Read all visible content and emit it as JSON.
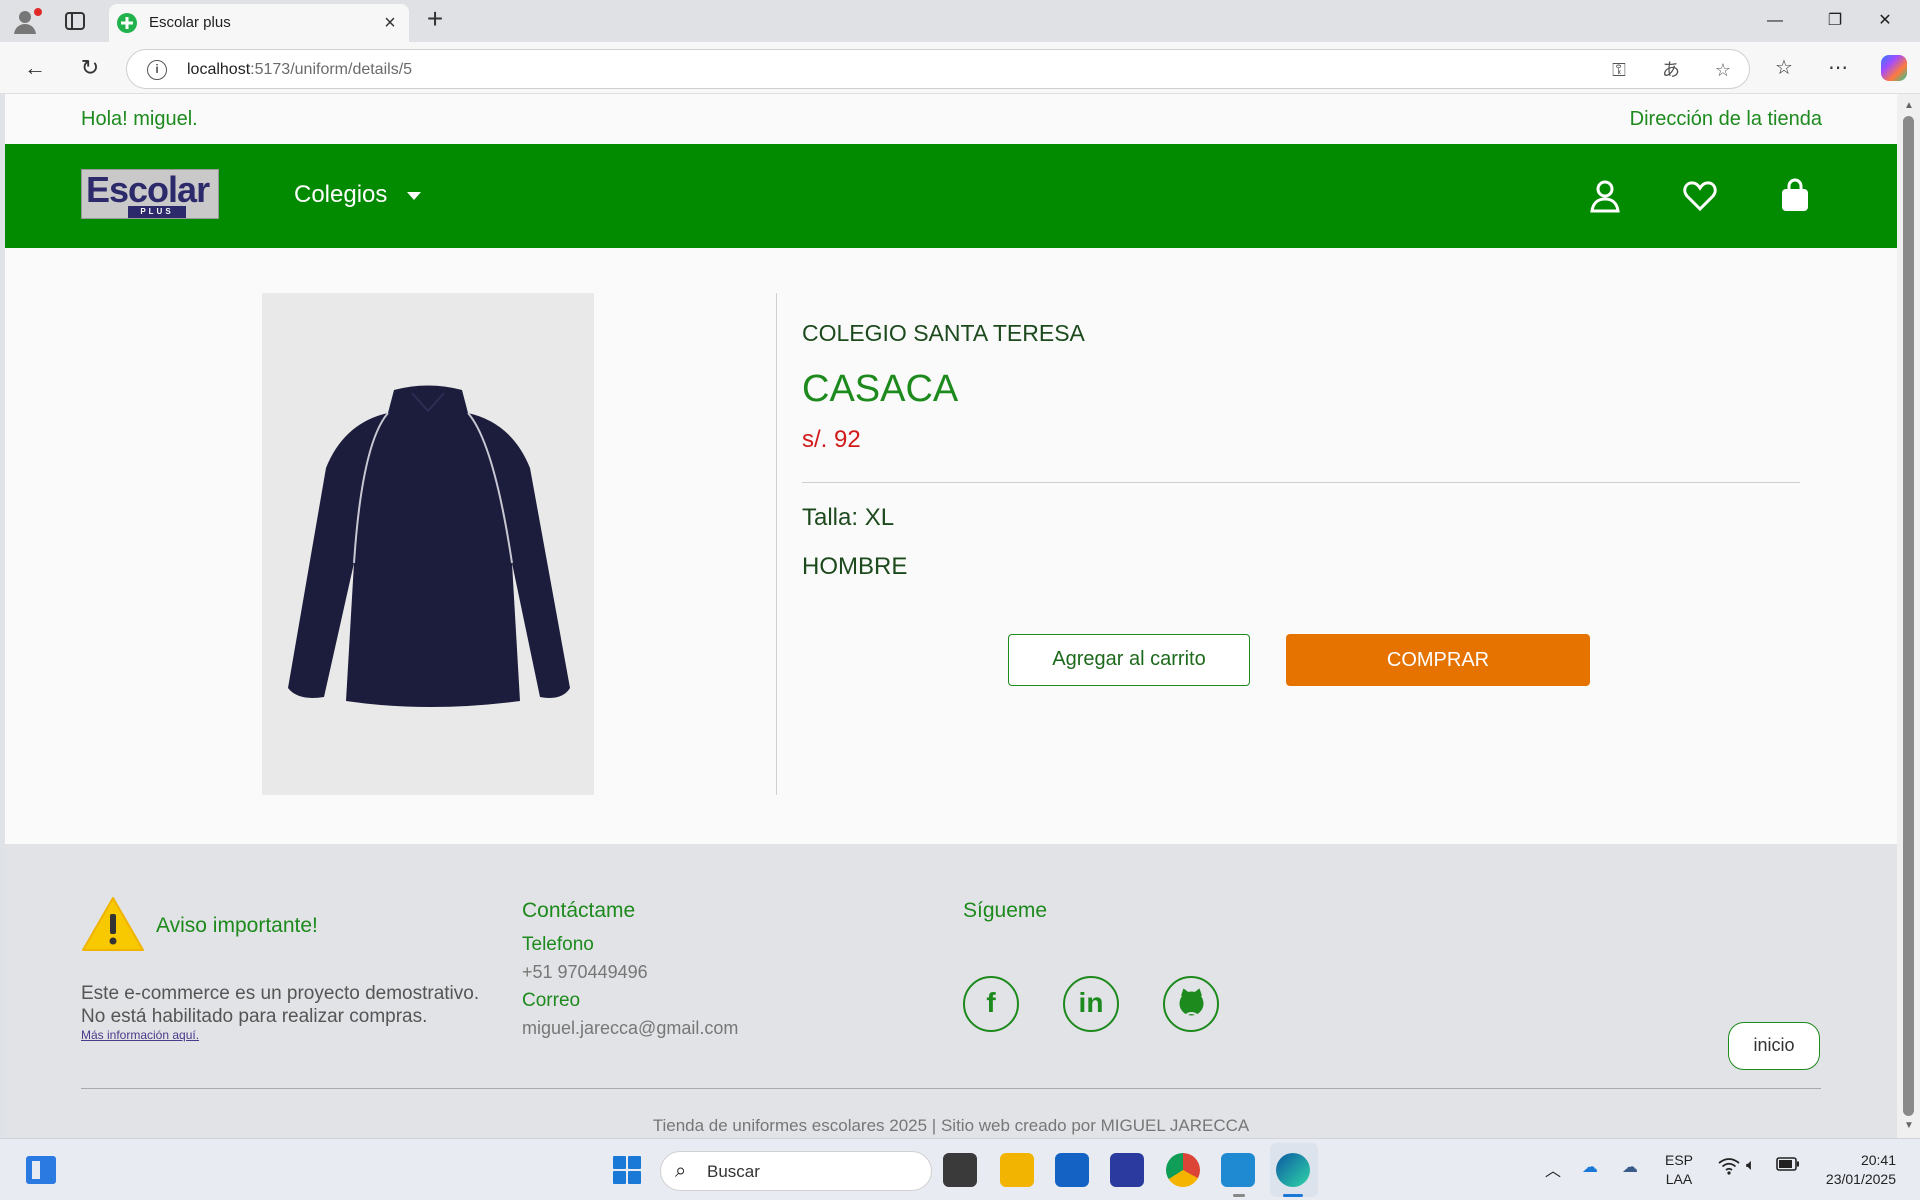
{
  "browser": {
    "tab_title": "Escolar plus",
    "url_host": "localhost",
    "url_path": ":5173/uniform/details/5"
  },
  "page": {
    "greeting": "Hola! miguel.",
    "store_address_link": "Dirección de la tienda",
    "nav": {
      "logo_text": "Escolar",
      "logo_subtext": "PLUS",
      "menu_label": "Colegios"
    },
    "product": {
      "school": "COLEGIO SANTA TERESA",
      "name": "CASACA",
      "price": "s/. 92",
      "size": "Talla: XL",
      "gender": "HOMBRE",
      "add_to_cart_label": "Agregar al carrito",
      "buy_label": "COMPRAR"
    },
    "footer": {
      "notice_title": "Aviso importante!",
      "notice_line1": "Este e-commerce es un proyecto demostrativo.",
      "notice_line2": "No está habilitado para realizar compras.",
      "notice_link": "Más información aquí.",
      "contact_title": "Contáctame",
      "phone_label": "Telefono",
      "phone_value": "+51 970449496",
      "email_label": "Correo",
      "email_value": "miguel.jarecca@gmail.com",
      "follow_title": "Sígueme",
      "home_button": "inicio",
      "copyright": "Tienda de uniformes escolares 2025   |   Sitio web creado por MIGUEL JARECCA"
    }
  },
  "taskbar": {
    "search_placeholder": "Buscar",
    "lang_line1": "ESP",
    "lang_line2": "LAA",
    "time": "20:41",
    "date": "23/01/2025"
  },
  "colors": {
    "brand_green": "#028a00",
    "buy_orange": "#e67300",
    "price_red": "#d11a1a"
  }
}
